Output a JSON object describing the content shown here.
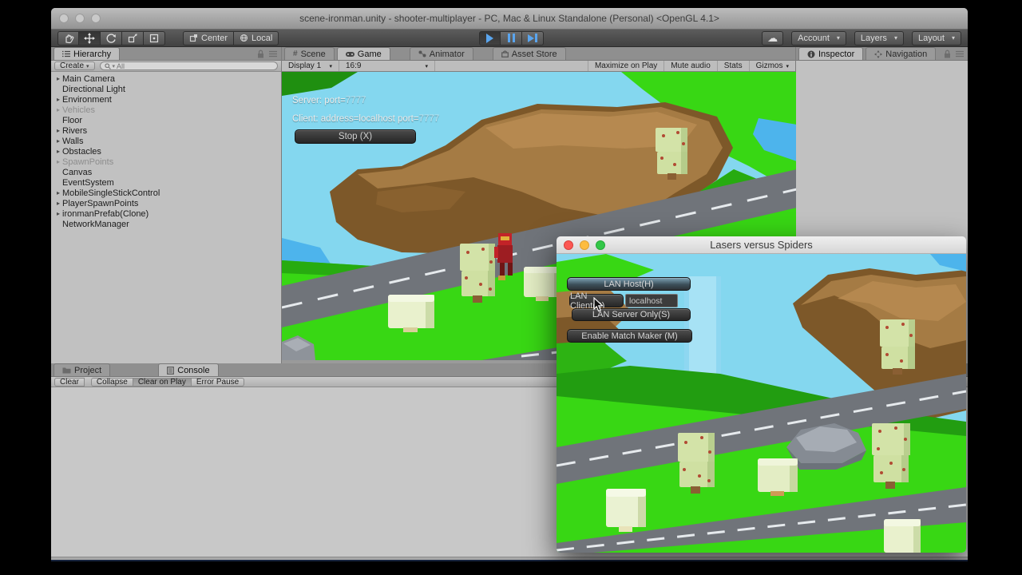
{
  "window": {
    "title": "scene-ironman.unity - shooter-multiplayer - PC, Mac & Linux Standalone (Personal) <OpenGL 4.1>"
  },
  "toolbar": {
    "center_label": "Center",
    "local_label": "Local",
    "account_label": "Account",
    "layers_label": "Layers",
    "layout_label": "Layout"
  },
  "hierarchy": {
    "tab_label": "Hierarchy",
    "create_label": "Create",
    "search_filter": "All",
    "items": [
      {
        "label": "Main Camera"
      },
      {
        "label": "Directional Light"
      },
      {
        "label": "Environment"
      },
      {
        "label": "Vehicles"
      },
      {
        "label": "Floor"
      },
      {
        "label": "Rivers"
      },
      {
        "label": "Walls"
      },
      {
        "label": "Obstacles"
      },
      {
        "label": "SpawnPoints"
      },
      {
        "label": "Canvas"
      },
      {
        "label": "EventSystem"
      },
      {
        "label": "MobileSingleStickControl"
      },
      {
        "label": "PlayerSpawnPoints"
      },
      {
        "label": "ironmanPrefab(Clone)"
      },
      {
        "label": "NetworkManager"
      }
    ]
  },
  "center_tabs": {
    "scene": "Scene",
    "game": "Game",
    "animator": "Animator",
    "asset_store": "Asset Store"
  },
  "game_toolbar": {
    "display": "Display 1",
    "aspect": "16:9",
    "maximize_on_play": "Maximize on Play",
    "mute_audio": "Mute audio",
    "stats": "Stats",
    "gizmos": "Gizmos"
  },
  "game_overlay": {
    "server_label": "Server: port=",
    "server_port": "7777",
    "client_label": "Client: address=localhost port=",
    "client_port": "7777",
    "stop_label": "Stop (X)"
  },
  "right_panel": {
    "inspector_tab": "Inspector",
    "navigation_tab": "Navigation"
  },
  "bottom_panel": {
    "project_tab": "Project",
    "console_tab": "Console",
    "buttons": [
      "Clear",
      "Collapse",
      "Clear on Play",
      "Error Pause"
    ]
  },
  "game_window": {
    "title": "Lasers versus Spiders",
    "lan_host_label": "LAN Host(H)",
    "lan_client_label": "LAN Client(C)",
    "client_address_value": "localhost",
    "lan_server_label": "LAN Server Only(S)",
    "match_maker_label": "Enable Match Maker (M)"
  },
  "colors": {
    "play_icon_blue": "#5aa5ee",
    "terrain_green": "#38d714",
    "mesa_brown": "#a57b44",
    "sky_cyan": "#84d7ef",
    "road_gray": "#70747a"
  }
}
